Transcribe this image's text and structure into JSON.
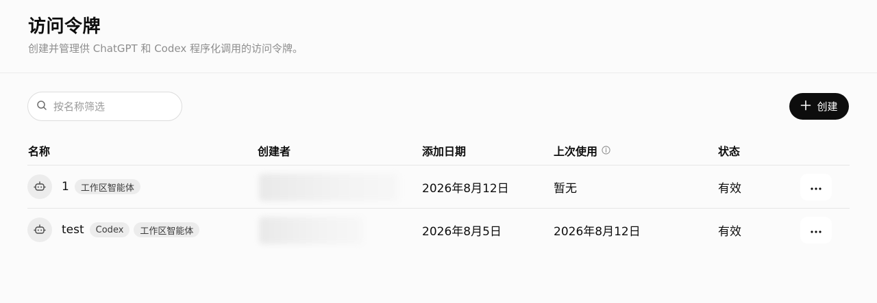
{
  "header": {
    "title": "访问令牌",
    "subtitle": "创建并管理供 ChatGPT 和 Codex 程序化调用的访问令牌。"
  },
  "toolbar": {
    "search_placeholder": "按名称筛选",
    "search_value": "",
    "create_label": "创建"
  },
  "table": {
    "columns": {
      "name": "名称",
      "creator": "创建者",
      "added": "添加日期",
      "last_used": "上次使用",
      "status": "状态"
    },
    "rows": [
      {
        "name": "1",
        "tags": [
          "工作区智能体"
        ],
        "added": "2026年8月12日",
        "last_used": "暂无",
        "status": "有效"
      },
      {
        "name": "test",
        "tags": [
          "Codex",
          "工作区智能体"
        ],
        "added": "2026年8月5日",
        "last_used": "2026年8月12日",
        "status": "有效"
      }
    ]
  },
  "icons": {
    "search": "search-icon",
    "create": "plus-icon",
    "info": "info-icon",
    "row_avatar": "robot-icon",
    "row_menu": "more-horizontal-icon"
  },
  "colors": {
    "primary_button": "#0d0d0d",
    "tag_background": "#ececec",
    "muted_text": "#8e8e8e"
  }
}
